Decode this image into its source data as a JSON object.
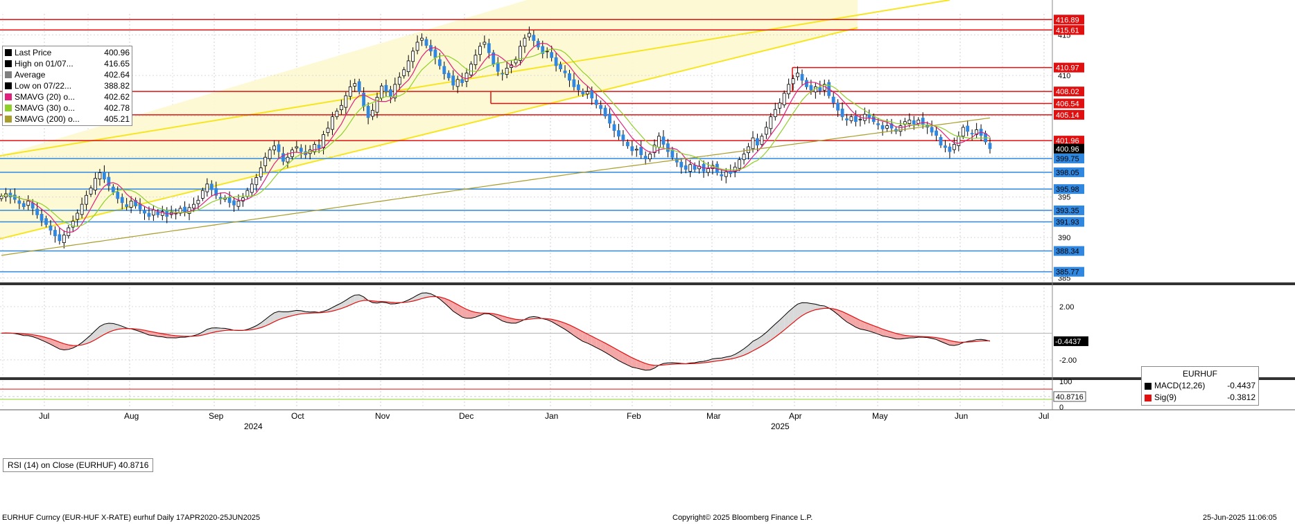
{
  "chart_data": {
    "type": "candlestick",
    "security": "EURHUF",
    "dates": [
      "Jul",
      "Aug",
      "Sep",
      "Oct",
      "Nov",
      "Dec",
      "Jan",
      "Feb",
      "Mar",
      "Apr",
      "May",
      "Jun",
      "Jul"
    ],
    "years": [
      "2024",
      "2025"
    ],
    "y_ticks": [
      385,
      390,
      395,
      400,
      405,
      410,
      415
    ],
    "ylim": [
      384.8,
      417.6
    ],
    "last_price_value": 400.96,
    "closes": [
      395.1,
      395.4,
      395.0,
      394.7,
      394.2,
      393.8,
      394.5,
      393.6,
      392.8,
      392.1,
      391.6,
      390.9,
      390.2,
      389.6,
      390.3,
      391.2,
      392.0,
      393.0,
      394.1,
      395.2,
      396.1,
      397.3,
      398.0,
      397.2,
      396.4,
      395.6,
      394.8,
      394.3,
      393.8,
      394.5,
      393.9,
      393.5,
      393.0,
      392.6,
      393.4,
      392.8,
      393.2,
      392.6,
      393.1,
      393.0,
      393.6,
      393.2,
      393.7,
      394.1,
      394.6,
      395.8,
      396.6,
      395.9,
      395.2,
      394.8,
      394.9,
      394.3,
      394.0,
      394.5,
      394.9,
      395.8,
      396.6,
      397.4,
      398.6,
      399.9,
      400.8,
      401.3,
      400.6,
      399.4,
      399.9,
      400.8,
      401.2,
      400.6,
      400.2,
      400.8,
      401.5,
      401.0,
      402.7,
      403.5,
      404.9,
      405.6,
      406.3,
      407.5,
      408.6,
      409.0,
      408.0,
      406.2,
      404.8,
      405.7,
      407.3,
      408.7,
      408.0,
      407.4,
      408.9,
      409.8,
      410.7,
      411.8,
      413.0,
      414.1,
      414.6,
      413.7,
      413.0,
      412.2,
      411.2,
      410.2,
      409.7,
      408.8,
      409.5,
      409.1,
      410.3,
      411.4,
      412.5,
      413.6,
      414.1,
      412.8,
      411.4,
      410.5,
      410.2,
      410.9,
      411.3,
      412.0,
      413.6,
      414.6,
      415.2,
      414.3,
      413.5,
      412.7,
      413.0,
      412.2,
      411.2,
      410.8,
      410.3,
      409.4,
      408.6,
      408.2,
      407.7,
      408.0,
      407.2,
      406.4,
      405.9,
      405.0,
      404.1,
      403.2,
      402.5,
      402.0,
      401.3,
      400.7,
      400.9,
      400.2,
      399.7,
      400.3,
      401.4,
      402.5,
      401.5,
      400.6,
      399.9,
      399.3,
      398.7,
      398.4,
      399.0,
      398.4,
      398.8,
      398.2,
      398.5,
      398.9,
      398.0,
      397.6,
      398.1,
      397.9,
      398.7,
      399.6,
      400.3,
      401.2,
      402.3,
      401.4,
      402.5,
      403.6,
      404.9,
      405.8,
      406.6,
      407.8,
      408.9,
      409.6,
      410.3,
      409.4,
      408.6,
      408.2,
      408.6,
      408.1,
      408.9,
      407.5,
      406.6,
      405.7,
      404.9,
      404.5,
      404.9,
      404.3,
      404.6,
      405.2,
      404.8,
      404.3,
      403.9,
      403.4,
      403.8,
      403.5,
      403.1,
      403.8,
      404.3,
      404.5,
      404.0,
      404.5,
      404.0,
      403.6,
      403.0,
      402.6,
      401.4,
      401.1,
      400.6,
      401.5,
      402.5,
      403.6,
      403.1,
      402.8,
      403.3,
      402.6,
      401.8,
      400.96
    ],
    "price_levels": [
      416.89,
      415.61,
      410.97,
      408.02,
      406.54,
      405.14,
      401.96,
      399.75,
      398.05,
      395.98,
      393.35,
      391.93,
      388.34,
      385.77
    ],
    "price_level_labels": [
      "416.89",
      "415.61",
      "410.97",
      "408.02",
      "406.54",
      "405.14",
      "401.96",
      "399.75",
      "398.05",
      "395.98",
      "393.35",
      "391.93",
      "388.34",
      "385.77"
    ],
    "hidden_price_label": "402.62",
    "last_price_label": "400.96",
    "macd": {
      "y_ticks": [
        2.0,
        -2.0
      ],
      "y_tick_labels": [
        "2.00",
        "-2.00"
      ],
      "ylim": [
        -3.2,
        3.4
      ],
      "zero": 0,
      "last_label": "-0.4437"
    },
    "rsi": {
      "y_ticks": [
        100,
        0
      ],
      "value": 40.8716,
      "label": "40.8716",
      "levels": [
        70,
        30
      ]
    }
  },
  "legend": {
    "items": [
      {
        "name": "Last Price",
        "value": "400.96",
        "color": "#000000"
      },
      {
        "name": "High on 01/07...",
        "value": "416.65",
        "color": "#000000"
      },
      {
        "name": "Average",
        "value": "402.64",
        "color": "#7f7f7f"
      },
      {
        "name": "Low on 07/22...",
        "value": "388.82",
        "color": "#000000"
      },
      {
        "name": "SMAVG (20)   o...",
        "value": "402.62",
        "color": "#e0207a"
      },
      {
        "name": "SMAVG (30)   o...",
        "value": "402.78",
        "color": "#8fcf2a"
      },
      {
        "name": "SMAVG (200)  o...",
        "value": "405.21",
        "color": "#a89c2a"
      }
    ]
  },
  "macd_legend": {
    "title": "EURHUF",
    "items": [
      {
        "name": "MACD(12,26)",
        "value": "-0.4437",
        "color": "#000000"
      },
      {
        "name": "Sig(9)",
        "value": "-0.3812",
        "color": "#e01010"
      }
    ]
  },
  "rsi_legend": {
    "text": "RSI (14)   on Close (EURHUF) 40.8716"
  },
  "footer": {
    "left": "EURHUF Curncy (EUR-HUF X-RATE) eurhuf  Daily 17APR2020-25JUN2025",
    "center": "Copyright© 2025 Bloomberg Finance L.P.",
    "right": "25-Jun-2025 11:06:05"
  },
  "colors": {
    "up": "#000000",
    "down": "#2f87e0",
    "channel": "#f7e51f",
    "channel_fill": "#fdf8cf",
    "resistance": "#e01010",
    "support": "#2f87e0",
    "sma20": "#e0207a",
    "sma30": "#8fcf2a",
    "sma200": "#a89c2a"
  }
}
